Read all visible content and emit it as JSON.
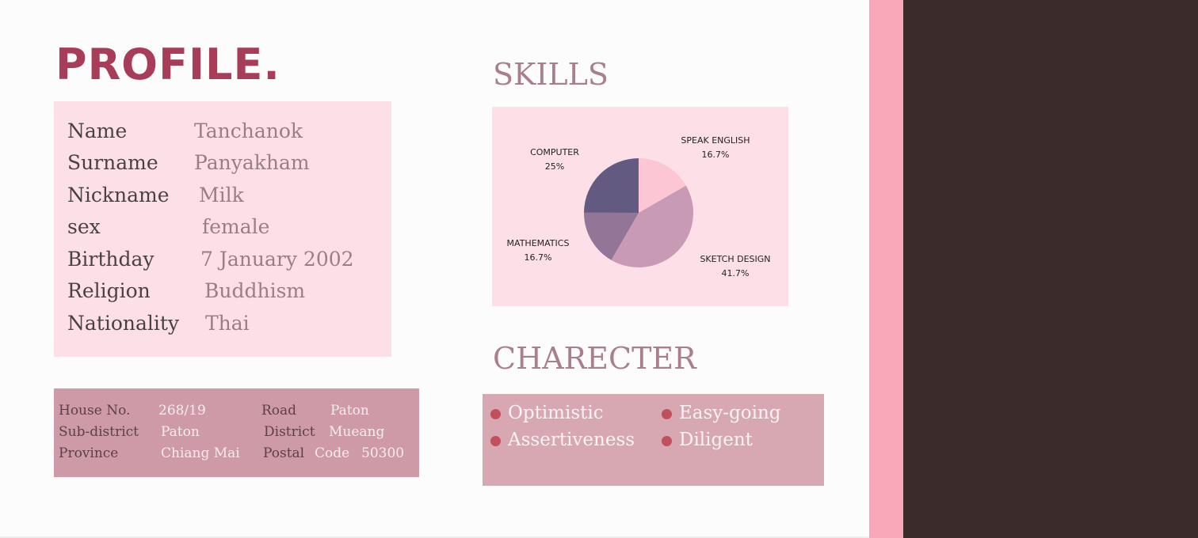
{
  "profile": {
    "title": "PROFILE.",
    "rows": [
      {
        "label": "Name",
        "value": "Tanchanok"
      },
      {
        "label": "Surname",
        "value": "Panyakham"
      },
      {
        "label": "Nickname",
        "value": "Milk"
      },
      {
        "label": "sex",
        "value": "female"
      },
      {
        "label": "Birthday",
        "value": "7 January 2002"
      },
      {
        "label": "Religion",
        "value": "Buddhism"
      },
      {
        "label": "Nationality",
        "value": "Thai"
      }
    ]
  },
  "address": {
    "house_label": "House No.",
    "house_value": "268/19",
    "road_label": "Road",
    "road_value": "Paton",
    "subdistrict_label": "Sub-district",
    "subdistrict_value": "Paton",
    "district_label": "District",
    "district_value": "Mueang",
    "province_label": "Province",
    "province_value": "Chiang Mai",
    "postal_label": "Postal",
    "postal_code_label": "Code",
    "postal_value": "50300"
  },
  "skills": {
    "title": "SKILLS"
  },
  "chart_data": {
    "type": "pie",
    "title": "",
    "slices": [
      {
        "label": "SPEAK ENGLISH",
        "value": 16.7,
        "display": "16.7%",
        "color": "#fcc6d4"
      },
      {
        "label": "SKETCH DESIGN",
        "value": 41.7,
        "display": "41.7%",
        "color": "#c89ab5"
      },
      {
        "label": "MATHEMATICS",
        "value": 16.7,
        "display": "16.7%",
        "color": "#937597"
      },
      {
        "label": "COMPUTER",
        "value": 25,
        "display": "25%",
        "color": "#625a80"
      }
    ]
  },
  "character": {
    "title": "CHARECTER",
    "items": [
      "Optimistic",
      "Easy-going",
      "Assertiveness",
      "Diligent"
    ]
  },
  "colors": {
    "accent_dark": "#a83d5a",
    "pink_strip": "#f9a8ba",
    "dark_panel": "#3c2b2b"
  }
}
